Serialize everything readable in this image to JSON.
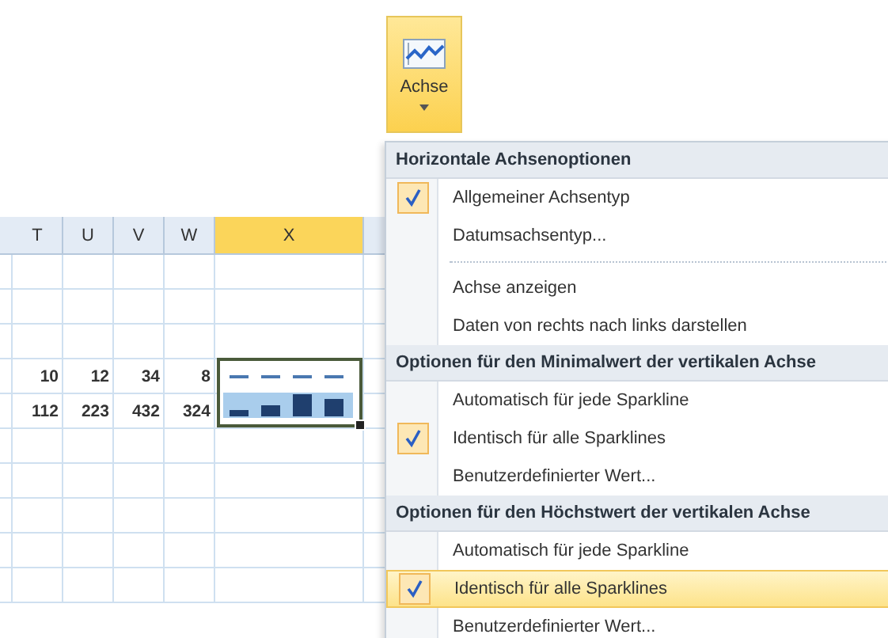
{
  "ribbon": {
    "button": {
      "label": "Achse",
      "pressed": true
    }
  },
  "sheet": {
    "columns": [
      {
        "label": "T",
        "selected": false
      },
      {
        "label": "U",
        "selected": false
      },
      {
        "label": "V",
        "selected": false
      },
      {
        "label": "W",
        "selected": false
      },
      {
        "label": "X",
        "selected": true
      }
    ],
    "rows": [
      [
        "",
        "",
        "",
        ""
      ],
      [
        "",
        "",
        "",
        ""
      ],
      [
        "",
        "",
        "",
        ""
      ],
      [
        "10",
        "12",
        "34",
        "8"
      ],
      [
        "112",
        "223",
        "432",
        "324"
      ],
      [
        "",
        "",
        "",
        ""
      ],
      [
        "",
        "",
        "",
        ""
      ],
      [
        "",
        "",
        "",
        ""
      ],
      [
        "",
        "",
        "",
        ""
      ],
      [
        "",
        "",
        "",
        ""
      ]
    ]
  },
  "menu": {
    "items": [
      {
        "kind": "header",
        "label": "Horizontale Achsenoptionen"
      },
      {
        "kind": "item",
        "label": "Allgemeiner Achsentyp",
        "checked": true,
        "highlighted": false
      },
      {
        "kind": "item",
        "label": "Datumsachsentyp...",
        "checked": false,
        "highlighted": false
      },
      {
        "kind": "separator"
      },
      {
        "kind": "item",
        "label": "Achse anzeigen",
        "checked": false,
        "highlighted": false
      },
      {
        "kind": "item",
        "label": "Daten von rechts nach links darstellen",
        "checked": false,
        "highlighted": false
      },
      {
        "kind": "header",
        "label": "Optionen für den Minimalwert der vertikalen Achse"
      },
      {
        "kind": "item",
        "label": "Automatisch für jede Sparkline",
        "checked": false,
        "highlighted": false
      },
      {
        "kind": "item",
        "label": "Identisch für alle Sparklines",
        "checked": true,
        "highlighted": false
      },
      {
        "kind": "item",
        "label": "Benutzerdefinierter Wert...",
        "checked": false,
        "highlighted": false
      },
      {
        "kind": "header",
        "label": "Optionen für den Höchstwert der vertikalen Achse"
      },
      {
        "kind": "item",
        "label": "Automatisch für jede Sparkline",
        "checked": false,
        "highlighted": false
      },
      {
        "kind": "item",
        "label": "Identisch für alle Sparklines",
        "checked": true,
        "highlighted": true
      },
      {
        "kind": "item",
        "label": "Benutzerdefinierter Wert...",
        "checked": false,
        "highlighted": false
      }
    ]
  }
}
